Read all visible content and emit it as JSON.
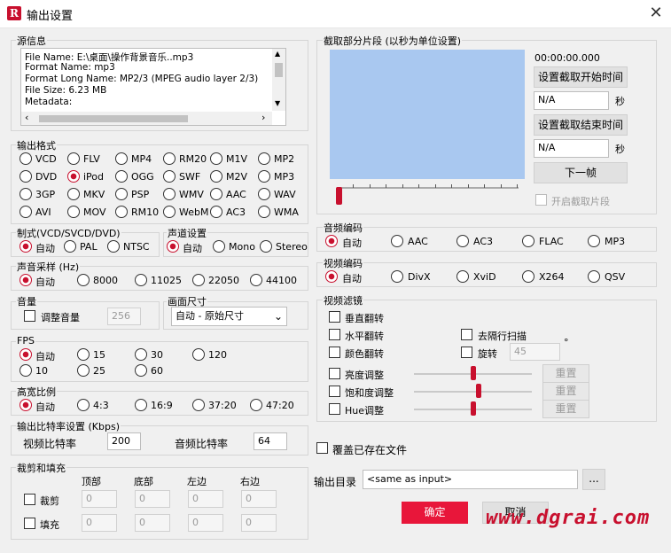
{
  "window": {
    "title": "输出设置",
    "close": "✕",
    "logo": "R"
  },
  "source": {
    "label": "源信息",
    "lines": [
      "File Name: E:\\桌面\\操作背景音乐..mp3",
      "Format Name: mp3",
      "Format Long Name: MP2/3 (MPEG audio layer 2/3)",
      "File Size: 6.23 MB",
      "Metadata:"
    ]
  },
  "format": {
    "label": "输出格式",
    "selected": "iPod",
    "options": [
      [
        "VCD",
        "FLV",
        "MP4",
        "RM20",
        "M1V",
        "MP2"
      ],
      [
        "DVD",
        "iPod",
        "OGG",
        "SWF",
        "M2V",
        "MP3"
      ],
      [
        "3GP",
        "MKV",
        "PSP",
        "WMV",
        "AAC",
        "WAV"
      ],
      [
        "AVI",
        "MOV",
        "RM10",
        "WebM",
        "AC3",
        "WMA"
      ]
    ]
  },
  "system": {
    "label": "制式(VCD/SVCD/DVD)",
    "options": [
      "自动",
      "PAL",
      "NTSC"
    ],
    "selected": "自动"
  },
  "channel": {
    "label": "声道设置",
    "options": [
      "自动",
      "Mono",
      "Stereo"
    ],
    "selected": "自动"
  },
  "samplerate": {
    "label": "声音采样 (Hz)",
    "options": [
      "自动",
      "8000",
      "11025",
      "22050",
      "44100"
    ],
    "selected": "自动"
  },
  "volume": {
    "label": "音量",
    "checkbox": "调整音量",
    "value": "256"
  },
  "framesize": {
    "label": "画面尺寸",
    "value": "自动 - 原始尺寸"
  },
  "fps": {
    "label": "FPS",
    "row1": [
      "自动",
      "15",
      "30",
      "120"
    ],
    "row2": [
      "10",
      "25",
      "60"
    ],
    "selected": "自动"
  },
  "aspect": {
    "label": "高宽比例",
    "options": [
      "自动",
      "4:3",
      "16:9",
      "37:20",
      "47:20"
    ],
    "selected": "自动"
  },
  "bitrate": {
    "label": "输出比特率设置 (Kbps)",
    "video_label": "视频比特率",
    "video_value": "200",
    "audio_label": "音频比特率",
    "audio_value": "64"
  },
  "crop": {
    "label": "裁剪和填充",
    "cols": [
      "顶部",
      "底部",
      "左边",
      "右边"
    ],
    "rows": [
      {
        "name": "裁剪",
        "values": [
          "0",
          "0",
          "0",
          "0"
        ]
      },
      {
        "name": "填充",
        "values": [
          "0",
          "0",
          "0",
          "0"
        ]
      }
    ]
  },
  "clip": {
    "label": "截取部分片段 (以秒为单位设置)",
    "time": "00:00:00.000",
    "set_start": "设置截取开始时间",
    "start_value": "N/A",
    "set_end": "设置截取结束时间",
    "end_value": "N/A",
    "sec": "秒",
    "next_frame": "下一帧",
    "enable": "开启截取片段"
  },
  "audiocodec": {
    "label": "音频编码",
    "options": [
      "自动",
      "AAC",
      "AC3",
      "FLAC",
      "MP3"
    ],
    "selected": "自动"
  },
  "videocodec": {
    "label": "视频编码",
    "options": [
      "自动",
      "DivX",
      "XviD",
      "X264",
      "QSV"
    ],
    "selected": "自动"
  },
  "filter": {
    "label": "视频滤镜",
    "vflip": "垂直翻转",
    "hflip": "水平翻转",
    "color_flip": "颜色翻转",
    "deinterlace": "去隔行扫描",
    "rotate": "旋转",
    "rotate_value": "45",
    "degree": "°",
    "brightness": "亮度调整",
    "saturation": "饱和度调整",
    "hue": "Hue调整",
    "reset": "重置"
  },
  "overwrite": "覆盖已存在文件",
  "outdir": {
    "label": "输出目录",
    "value": "<same as input>",
    "browse": "..."
  },
  "ok": "确定",
  "cancel": "取消",
  "watermark": "www.dgrai.com",
  "colors": {
    "accent": "#c8102e",
    "primary_button": "#e8163a",
    "preview": "#a9c8f0"
  }
}
